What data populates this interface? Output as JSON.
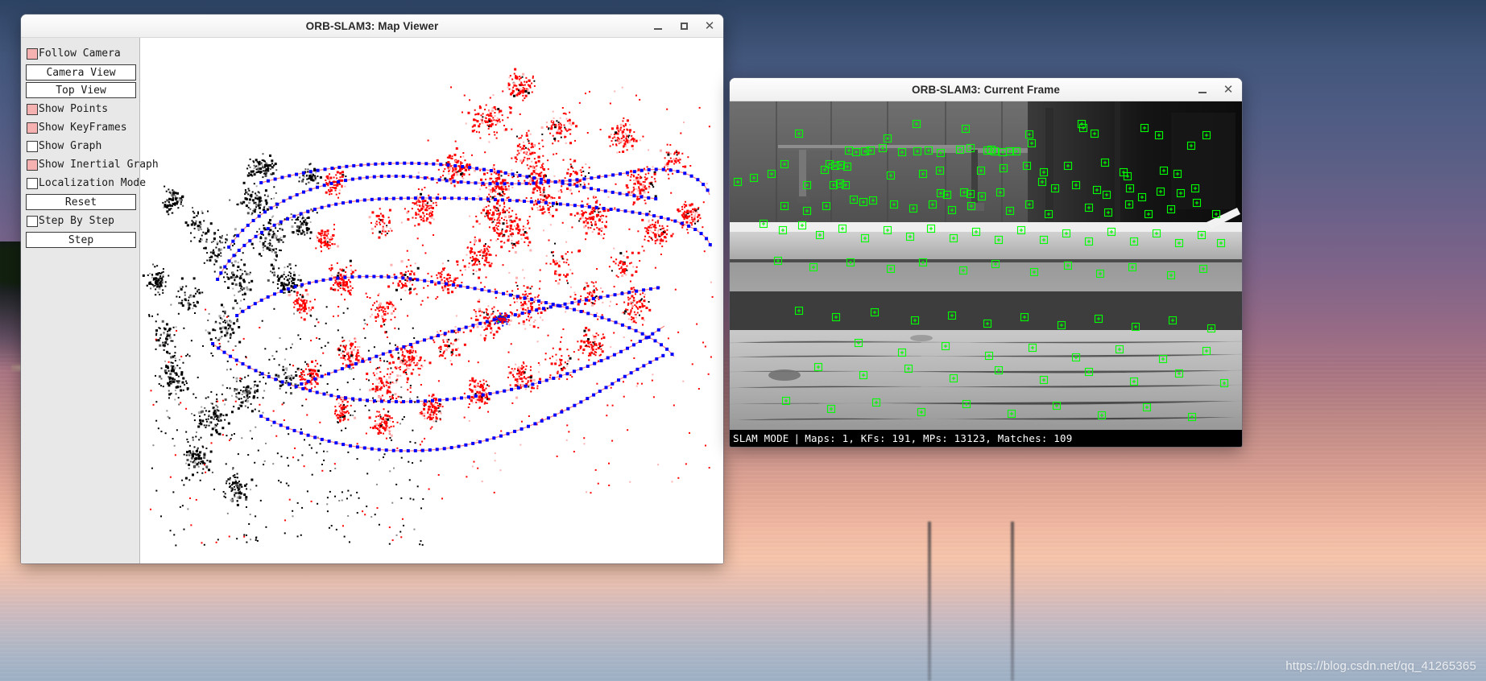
{
  "desktop": {
    "watermark": "https://blog.csdn.net/qq_41265365",
    "wallpaper_description": "sunset-harbor-photo"
  },
  "map_viewer": {
    "title": "ORB-SLAM3: Map Viewer",
    "window_buttons": {
      "minimize": "minimize-icon",
      "maximize": "maximize-icon",
      "close": "close-icon"
    },
    "panel": {
      "items": [
        {
          "type": "checkbox",
          "label": "Follow Camera",
          "checked": true
        },
        {
          "type": "button",
          "label": "Camera View"
        },
        {
          "type": "button",
          "label": "Top View"
        },
        {
          "type": "checkbox",
          "label": "Show Points",
          "checked": true
        },
        {
          "type": "checkbox",
          "label": "Show KeyFrames",
          "checked": true
        },
        {
          "type": "checkbox",
          "label": "Show Graph",
          "checked": false
        },
        {
          "type": "checkbox",
          "label": "Show Inertial Graph",
          "checked": true
        },
        {
          "type": "checkbox",
          "label": "Localization Mode",
          "checked": false
        },
        {
          "type": "button",
          "label": "Reset"
        },
        {
          "type": "checkbox",
          "label": "Step By Step",
          "checked": false
        },
        {
          "type": "button",
          "label": "Step"
        }
      ]
    },
    "colors": {
      "map_points_recent": "#ff0000",
      "map_points_old": "#000000",
      "keyframes": "#0000ff",
      "trajectory": "#ff8080",
      "current_camera": "#00ff00",
      "checkbox_checked": "#f6b1b1",
      "panel_background": "#e8e8e8"
    }
  },
  "current_frame": {
    "title": "ORB-SLAM3: Current Frame",
    "window_buttons": {
      "minimize": "minimize-icon",
      "close": "close-icon"
    },
    "status": {
      "mode": "SLAM MODE",
      "divider": "|",
      "stats": "Maps: 1, KFs: 191, MPs: 13123, Matches: 109",
      "maps": 1,
      "kfs": 191,
      "mps": 13123,
      "matches": 109
    },
    "feature_color": "#00ff00",
    "scene_description": "grayscale-indoor-concrete-scene"
  }
}
